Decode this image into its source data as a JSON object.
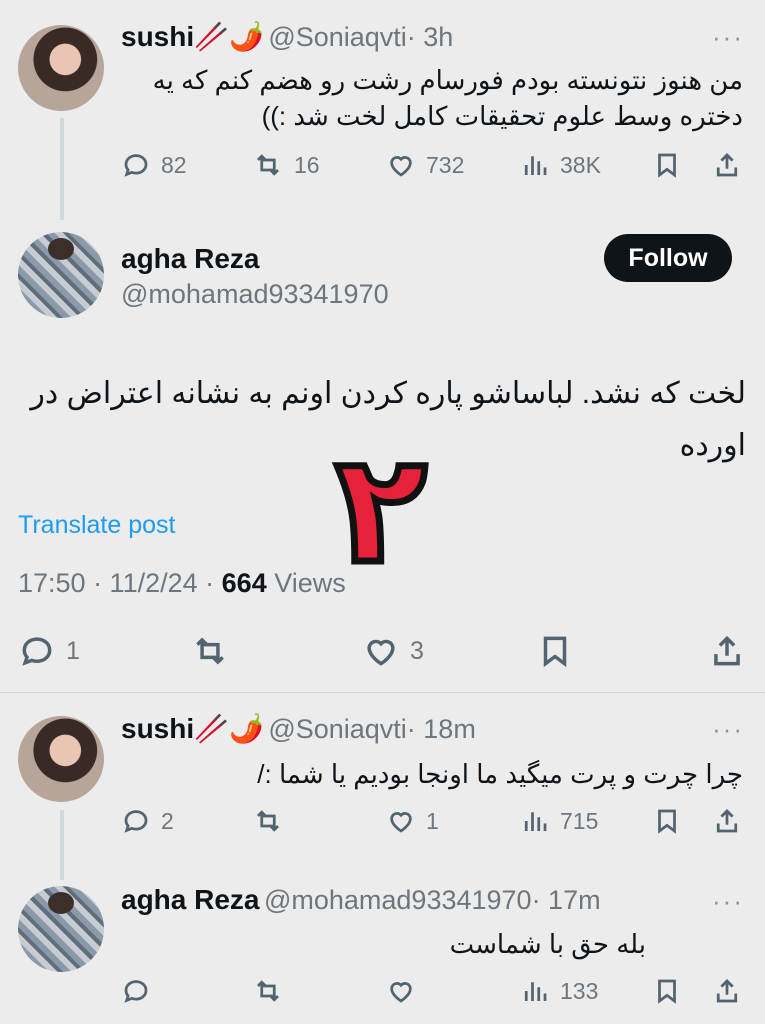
{
  "reply1": {
    "name": "sushi🥢🌶️",
    "handle": "@Soniaqvti",
    "time": "· 3h",
    "text": "من هنوز نتونسته بودم فورسام رشت رو هضم کنم که یه دختره وسط علوم تحقیقات کامل لخت شد :))",
    "replies": "82",
    "retweets": "16",
    "likes": "732",
    "views": "38K"
  },
  "main": {
    "name": "agha Reza",
    "handle": "@mohamad93341970",
    "follow_label": "Follow",
    "text": "لخت که نشد. لباساشو پاره کردن اونم به نشانه اعتراض در اورده",
    "overlay_numeral": "٢",
    "translate_label": "Translate post",
    "timestamp": "17:50 · 11/2/24 ·",
    "views_count": "664",
    "views_label": "Views",
    "replies": "1",
    "retweets": "",
    "likes": "3"
  },
  "reply2": {
    "name": "sushi🥢🌶️",
    "handle": "@Soniaqvti",
    "time": "· 18m",
    "text": "چرا چرت و پرت میگید ما اونجا بودیم یا شما :/",
    "replies": "2",
    "retweets": "",
    "likes": "1",
    "views": "715"
  },
  "reply3": {
    "name": "agha Reza",
    "handle": "@mohamad93341970",
    "time": "· 17m",
    "text": "بله حق با شماست",
    "replies": "",
    "retweets": "",
    "likes": "",
    "views": "133"
  },
  "colors": {
    "background": "#ececec",
    "link": "#1d9bf0",
    "numeral": "#e8213a"
  },
  "icons": [
    "reply-icon",
    "retweet-icon",
    "like-icon",
    "views-icon",
    "bookmark-icon",
    "share-icon",
    "more-icon"
  ]
}
